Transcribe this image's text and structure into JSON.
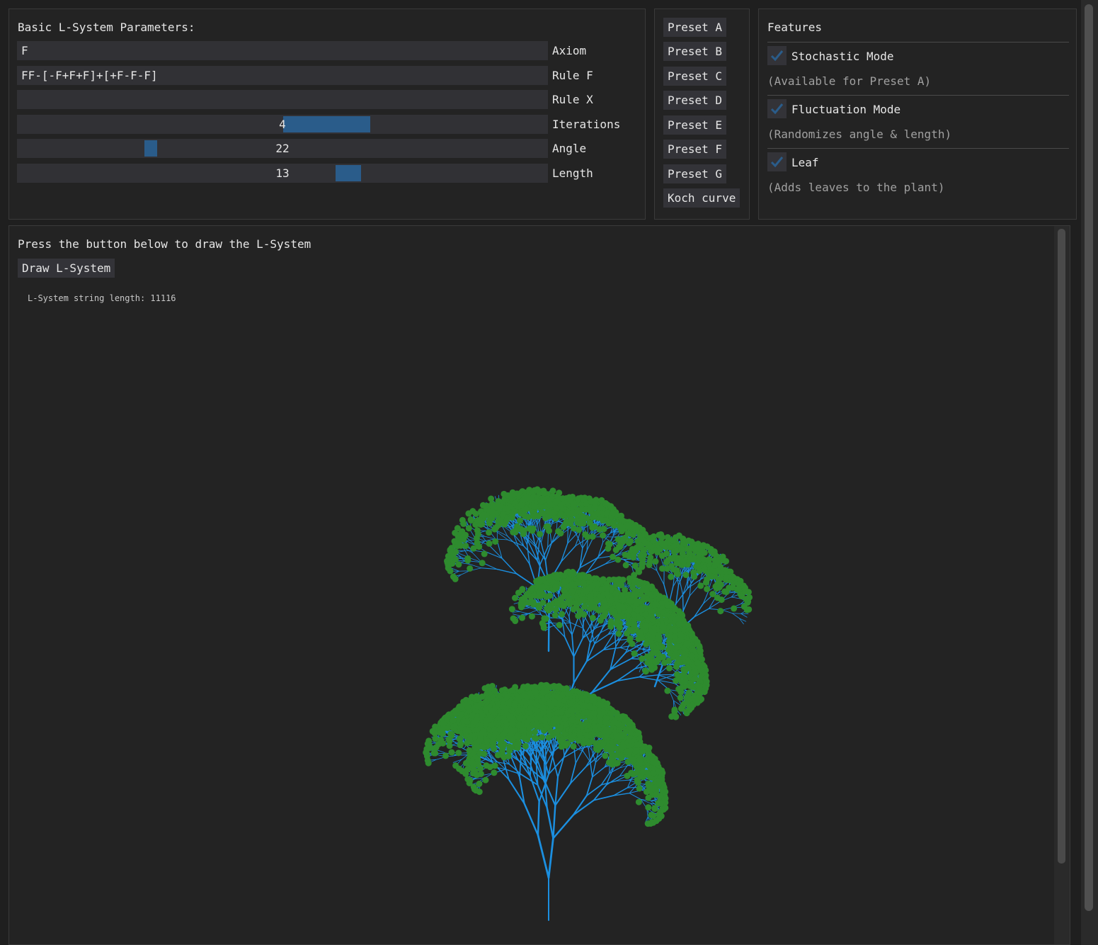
{
  "params": {
    "title": "Basic L-System Parameters:",
    "axiom": {
      "value": "F",
      "label": "Axiom"
    },
    "rule_f": {
      "value": "FF-[-F+F+F]+[+F-F-F]",
      "label": "Rule F"
    },
    "rule_x": {
      "value": "",
      "label": "Rule X"
    },
    "iterations": {
      "value": "4",
      "label": "Iterations"
    },
    "angle": {
      "value": "22",
      "label": "Angle"
    },
    "length": {
      "value": "13",
      "label": "Length"
    }
  },
  "presets": [
    "Preset A",
    "Preset B",
    "Preset C",
    "Preset D",
    "Preset E",
    "Preset F",
    "Preset G",
    "Koch curve"
  ],
  "features": {
    "title": "Features",
    "items": [
      {
        "label": "Stochastic Mode",
        "checked": true,
        "hint": "(Available for Preset A)"
      },
      {
        "label": "Fluctuation Mode",
        "checked": true,
        "hint": "(Randomizes angle & length)"
      },
      {
        "label": "Leaf",
        "checked": true,
        "hint": "(Adds leaves to the plant)"
      }
    ]
  },
  "draw": {
    "instruction": "Press the button below to draw the L-System",
    "button_label": "Draw L-System",
    "string_length_text": "L-System string length: 11116"
  },
  "colors": {
    "branch": "#1b8fe0",
    "leaf": "#2e8b2e",
    "accent": "#2a5c8a"
  }
}
